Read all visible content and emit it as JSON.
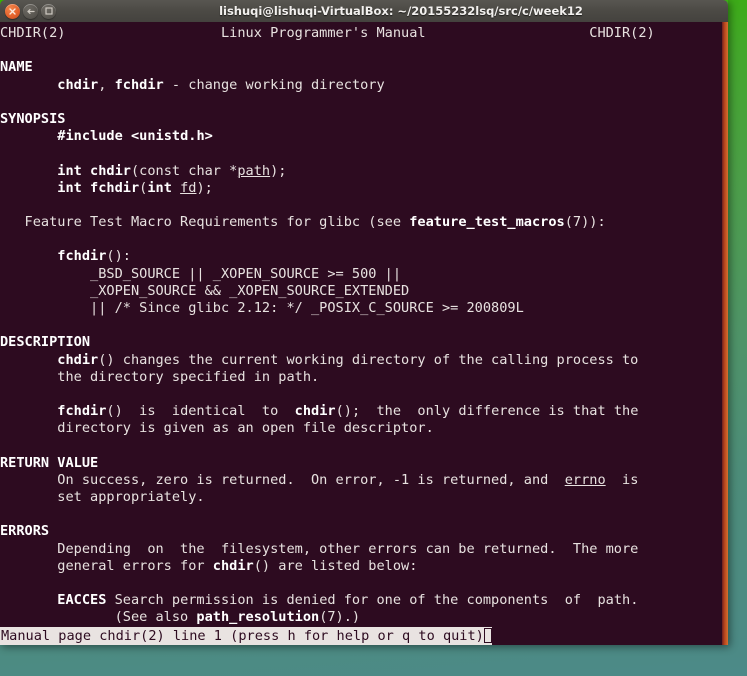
{
  "window": {
    "title": "lishuqi@lishuqi-VirtualBox: ~/20155232lsq/src/c/week12",
    "controls": [
      {
        "name": "close",
        "label": "×"
      },
      {
        "name": "minimize",
        "label": "−"
      },
      {
        "name": "maximize",
        "label": "□"
      }
    ]
  },
  "terminal": {
    "colors": {
      "background": "#2d0b20",
      "foreground": "#e8e2e0",
      "titlebar": "#4c4a45",
      "scrollbar": "#d6702f",
      "status_background": "#e9e3e1",
      "status_foreground": "#2d0b20"
    },
    "man_page": {
      "header_left": "CHDIR(2)",
      "header_center": "Linux Programmer's Manual",
      "header_right": "CHDIR(2)",
      "sections": [
        {
          "heading": "NAME",
          "body": [
            "       chdir, fchdir - change working directory"
          ]
        },
        {
          "heading": "SYNOPSIS",
          "body": [
            "       #include <unistd.h>",
            "",
            "       int chdir(const char *path);",
            "       int fchdir(int fd);",
            "",
            "   Feature Test Macro Requirements for glibc (see feature_test_macros(7)):",
            "",
            "       fchdir():",
            "           _BSD_SOURCE || _XOPEN_SOURCE >= 500 ||",
            "           _XOPEN_SOURCE && _XOPEN_SOURCE_EXTENDED",
            "           || /* Since glibc 2.12: */ _POSIX_C_SOURCE >= 200809L"
          ]
        },
        {
          "heading": "DESCRIPTION",
          "body": [
            "       chdir() changes the current working directory of the calling process to",
            "       the directory specified in path.",
            "",
            "       fchdir()  is  identical  to  chdir();  the  only difference is that the",
            "       directory is given as an open file descriptor."
          ]
        },
        {
          "heading": "RETURN VALUE",
          "body": [
            "       On success, zero is returned.  On error, -1 is returned, and  errno  is",
            "       set appropriately."
          ]
        },
        {
          "heading": "ERRORS",
          "body": [
            "       Depending  on  the  filesystem, other errors can be returned.  The more",
            "       general errors for chdir() are listed below:",
            "",
            "       EACCES Search permission is denied for one of the components  of  path.",
            "              (See also path_resolution(7).)"
          ]
        }
      ]
    },
    "status": {
      "text": "Manual page chdir(2) line 1 (press h for help or q to quit)"
    }
  }
}
